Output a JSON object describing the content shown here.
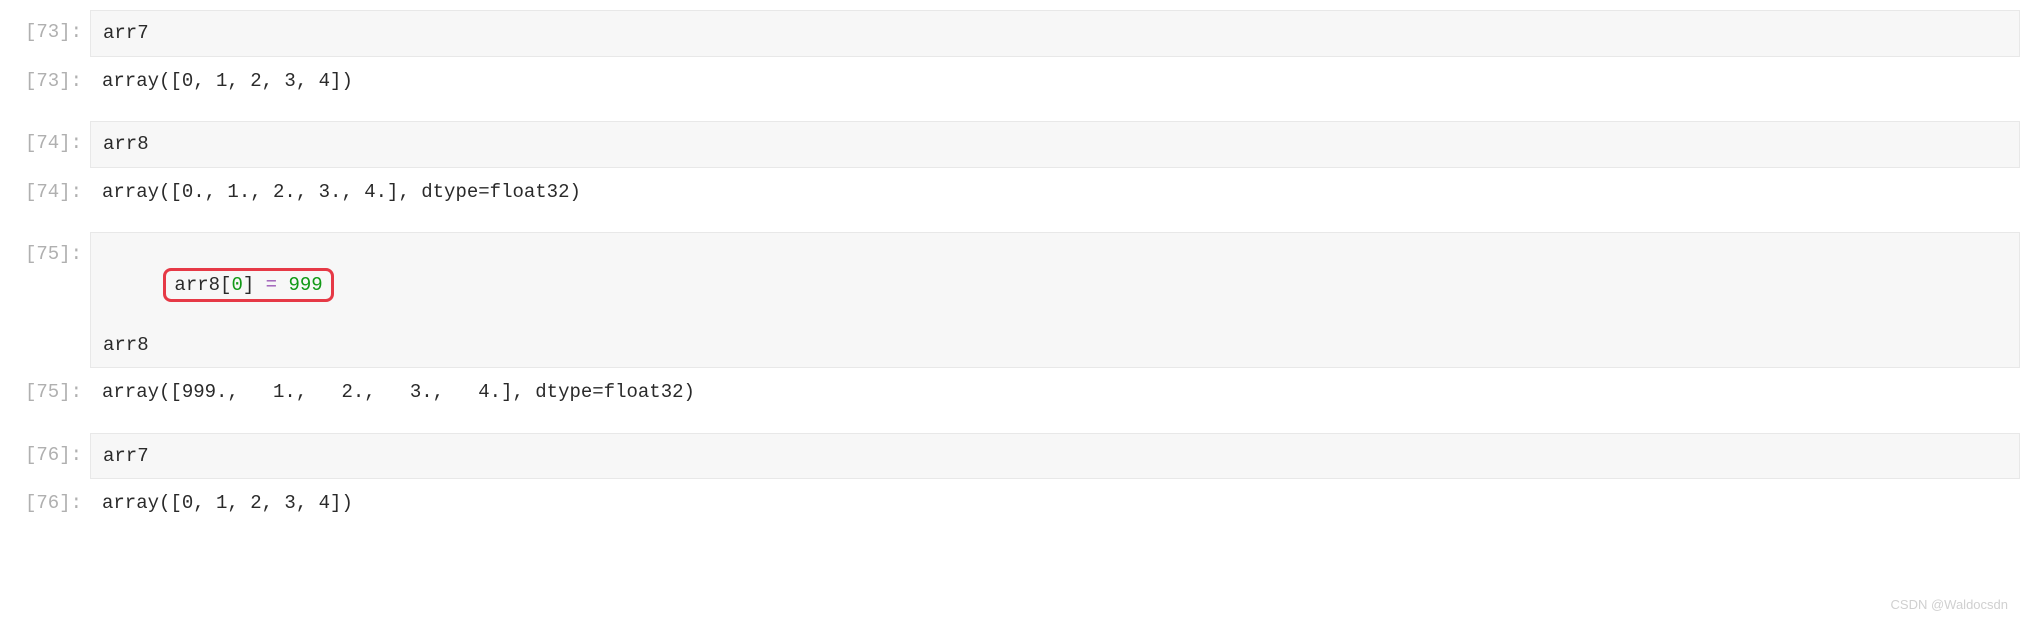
{
  "cells": [
    {
      "prompt_in": "[73]:",
      "input_lines": [
        {
          "plain": "arr7"
        }
      ],
      "prompt_out": "[73]:",
      "output": "array([0, 1, 2, 3, 4])"
    },
    {
      "prompt_in": "[74]:",
      "input_lines": [
        {
          "plain": "arr8"
        }
      ],
      "prompt_out": "[74]:",
      "output": "array([0., 1., 2., 3., 4.], dtype=float32)"
    },
    {
      "prompt_in": "[75]:",
      "input_lines": [
        {
          "highlighted": true,
          "parts": {
            "name": "arr8",
            "lbracket": "[",
            "index": "0",
            "rbracket": "]",
            "space1": " ",
            "op": "=",
            "space2": " ",
            "value": "999"
          }
        },
        {
          "plain": "arr8"
        }
      ],
      "prompt_out": "[75]:",
      "output": "array([999.,   1.,   2.,   3.,   4.], dtype=float32)"
    },
    {
      "prompt_in": "[76]:",
      "input_lines": [
        {
          "plain": "arr7"
        }
      ],
      "prompt_out": "[76]:",
      "output": "array([0, 1, 2, 3, 4])"
    }
  ],
  "watermark": "CSDN @Waldocsdn"
}
